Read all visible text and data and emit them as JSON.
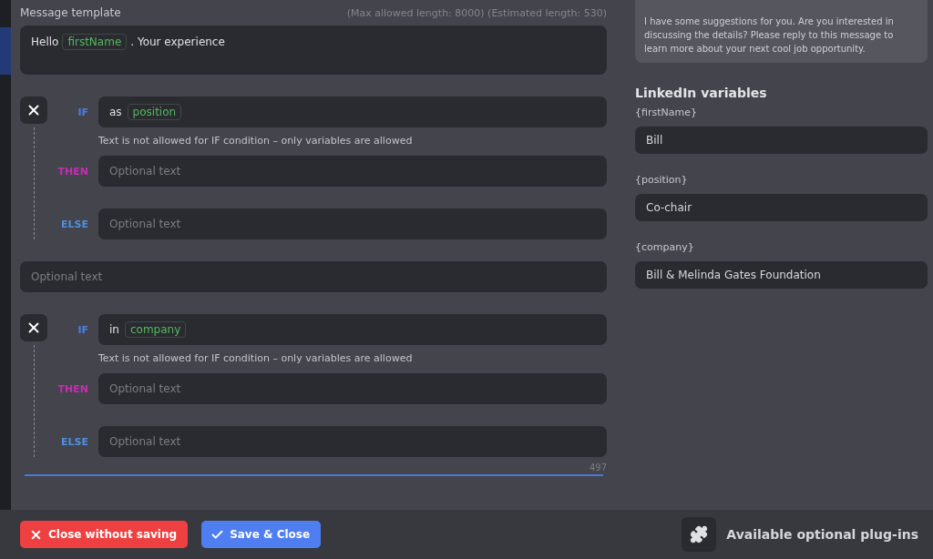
{
  "template": {
    "label": "Message template",
    "limits": "(Max allowed length: 8000) (Estimated length: 530)",
    "segments": [
      {
        "kind": "text",
        "text": "Hello"
      },
      {
        "kind": "variable",
        "text": "firstName"
      },
      {
        "kind": "text",
        "text": ". Your experience"
      }
    ]
  },
  "blocks": [
    {
      "kind": "condition",
      "if": {
        "label": "IF",
        "prefix": "as",
        "variable": "position"
      },
      "warning": "Text is not allowed for IF condition – only variables are allowed",
      "then": {
        "label": "THEN",
        "placeholder": "Optional text"
      },
      "else": {
        "label": "ELSE",
        "placeholder": "Optional text"
      }
    },
    {
      "kind": "text",
      "placeholder": "Optional text"
    },
    {
      "kind": "condition",
      "if": {
        "label": "IF",
        "prefix": "in",
        "variable": "company"
      },
      "warning": "Text is not allowed for IF condition – only variables are allowed",
      "then": {
        "label": "THEN",
        "placeholder": "Optional text"
      },
      "else": {
        "label": "ELSE",
        "placeholder": "Optional text"
      }
    }
  ],
  "counter": "497",
  "preview": {
    "text": "I have some suggestions for you. Are you interested in discussing the details? Please reply to this message to learn more about your next cool job opportunity."
  },
  "variables": {
    "title": "LinkedIn variables",
    "items": [
      {
        "label": "{firstName}",
        "value": "Bill"
      },
      {
        "label": "{position}",
        "value": "Co-chair"
      },
      {
        "label": "{company}",
        "value": "Bill & Melinda Gates Foundation"
      }
    ]
  },
  "footer": {
    "buttons": [
      {
        "kind": "danger",
        "label": "Close without saving"
      },
      {
        "kind": "primary",
        "label": "Save & Close"
      }
    ],
    "plugins": "Available optional plug-ins"
  }
}
